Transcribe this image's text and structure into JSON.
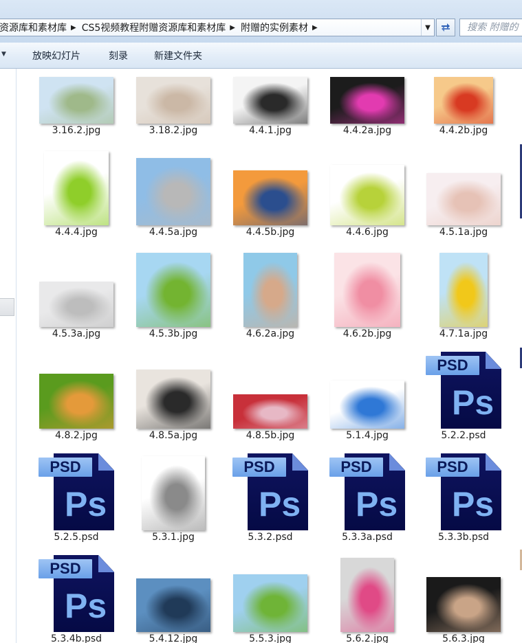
{
  "address": {
    "crumbs": [
      "资源库和素材库",
      "CS5视频教程附赠资源库和素材库",
      "附赠的实例素材"
    ],
    "search_placeholder": "搜索 附赠的"
  },
  "toolbar": {
    "items": [
      "放映幻灯片",
      "刻录",
      "新建文件夹"
    ]
  },
  "files": [
    {
      "name": "3.16.2.jpg",
      "kind": "photo",
      "colors": [
        "#cfe3f2",
        "#9fb98a"
      ]
    },
    {
      "name": "3.18.2.jpg",
      "kind": "photo",
      "colors": [
        "#e7e1da",
        "#cbb8a6"
      ]
    },
    {
      "name": "4.4.1.jpg",
      "kind": "photo",
      "colors": [
        "#f4f4f4",
        "#2a2a2a"
      ]
    },
    {
      "name": "4.4.2a.jpg",
      "kind": "photo",
      "colors": [
        "#1c1c1c",
        "#e23bb0"
      ]
    },
    {
      "name": "4.4.2b.jpg",
      "kind": "photo",
      "colors": [
        "#f6c98a",
        "#d83a22"
      ]
    },
    {
      "name": "4.4.4.jpg",
      "kind": "photo",
      "colors": [
        "#ffffff",
        "#8fce2a"
      ]
    },
    {
      "name": "4.4.5a.jpg",
      "kind": "photo",
      "colors": [
        "#8fbde6",
        "#b8b8b8"
      ]
    },
    {
      "name": "4.4.5b.jpg",
      "kind": "photo",
      "colors": [
        "#f39a3c",
        "#2b4e8e"
      ]
    },
    {
      "name": "4.4.6.jpg",
      "kind": "photo",
      "colors": [
        "#ffffff",
        "#b7d23a"
      ]
    },
    {
      "name": "4.5.1a.jpg",
      "kind": "photo",
      "colors": [
        "#f7eef0",
        "#e6c2b6"
      ]
    },
    {
      "name": "4.5.3a.jpg",
      "kind": "photo",
      "colors": [
        "#e9e9ea",
        "#bdbdbd"
      ]
    },
    {
      "name": "4.5.3b.jpg",
      "kind": "photo",
      "colors": [
        "#a7d7f2",
        "#73b431"
      ]
    },
    {
      "name": "4.6.2a.jpg",
      "kind": "photo",
      "colors": [
        "#8fc9e8",
        "#d6a98a"
      ]
    },
    {
      "name": "4.6.2b.jpg",
      "kind": "photo",
      "colors": [
        "#fbe3e6",
        "#f08ea3"
      ]
    },
    {
      "name": "4.7.1a.jpg",
      "kind": "photo",
      "colors": [
        "#bfe2f6",
        "#f1c81a"
      ]
    },
    {
      "name": "4.8.2.jpg",
      "kind": "photo",
      "colors": [
        "#5a9b1e",
        "#e49a3a"
      ]
    },
    {
      "name": "4.8.5a.jpg",
      "kind": "photo",
      "colors": [
        "#e9e4de",
        "#2a2a2a"
      ]
    },
    {
      "name": "4.8.5b.jpg",
      "kind": "photo",
      "colors": [
        "#c8303a",
        "#e7b8c5"
      ]
    },
    {
      "name": "5.1.4.jpg",
      "kind": "photo",
      "colors": [
        "#ffffff",
        "#2f78d6"
      ]
    },
    {
      "name": "5.2.2.psd",
      "kind": "psd"
    },
    {
      "name": "5.2.5.psd",
      "kind": "psd"
    },
    {
      "name": "5.3.1.jpg",
      "kind": "photo",
      "colors": [
        "#ffffff",
        "#8a8a8a"
      ]
    },
    {
      "name": "5.3.2.psd",
      "kind": "psd"
    },
    {
      "name": "5.3.3a.psd",
      "kind": "psd"
    },
    {
      "name": "5.3.3b.psd",
      "kind": "psd"
    },
    {
      "name": "5.3.4b.psd",
      "kind": "psd"
    },
    {
      "name": "5.4.12.jpg",
      "kind": "photo",
      "colors": [
        "#5c8fc0",
        "#203a58"
      ]
    },
    {
      "name": "5.5.3.jpg",
      "kind": "photo",
      "colors": [
        "#9fd0ef",
        "#6fb437"
      ]
    },
    {
      "name": "5.6.2.jpg",
      "kind": "photo",
      "colors": [
        "#d8d8d8",
        "#e04a86"
      ]
    },
    {
      "name": "5.6.3.jpg",
      "kind": "photo",
      "colors": [
        "#1a1a1a",
        "#c9a487"
      ]
    }
  ]
}
